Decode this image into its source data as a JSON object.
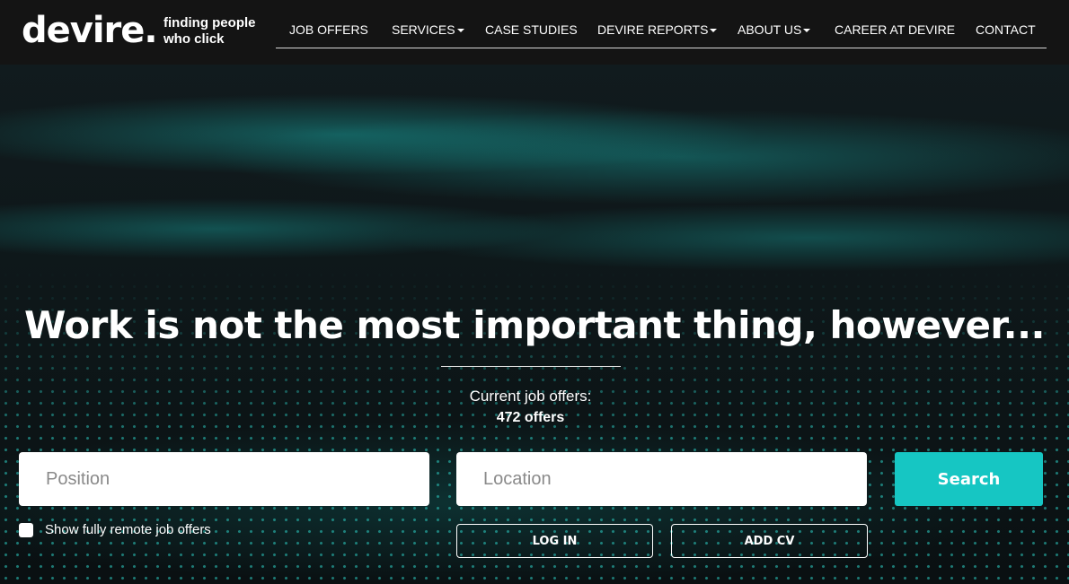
{
  "brand": {
    "logo": "devire.",
    "tagline_line1": "finding people",
    "tagline_line2": "who click"
  },
  "nav": {
    "job_offers": "JOB OFFERS",
    "services": "SERVICES",
    "case_studies": "CASE STUDIES",
    "devire_reports": "DEVIRE REPORTS",
    "about_us": "ABOUT US",
    "career": "CAREER AT DEVIRE",
    "contact": "CONTACT"
  },
  "hero": {
    "headline": "Work is not the most important thing, however...",
    "offers_label": "Current job offers:",
    "offers_count": "472 offers"
  },
  "search": {
    "position_placeholder": "Position",
    "location_placeholder": "Location",
    "button": "Search",
    "remote_label": "Show fully remote job offers"
  },
  "actions": {
    "log_in": "LOG IN",
    "add_cv": "ADD CV"
  },
  "colors": {
    "accent": "#16c6c3",
    "header_bg": "#141414"
  }
}
